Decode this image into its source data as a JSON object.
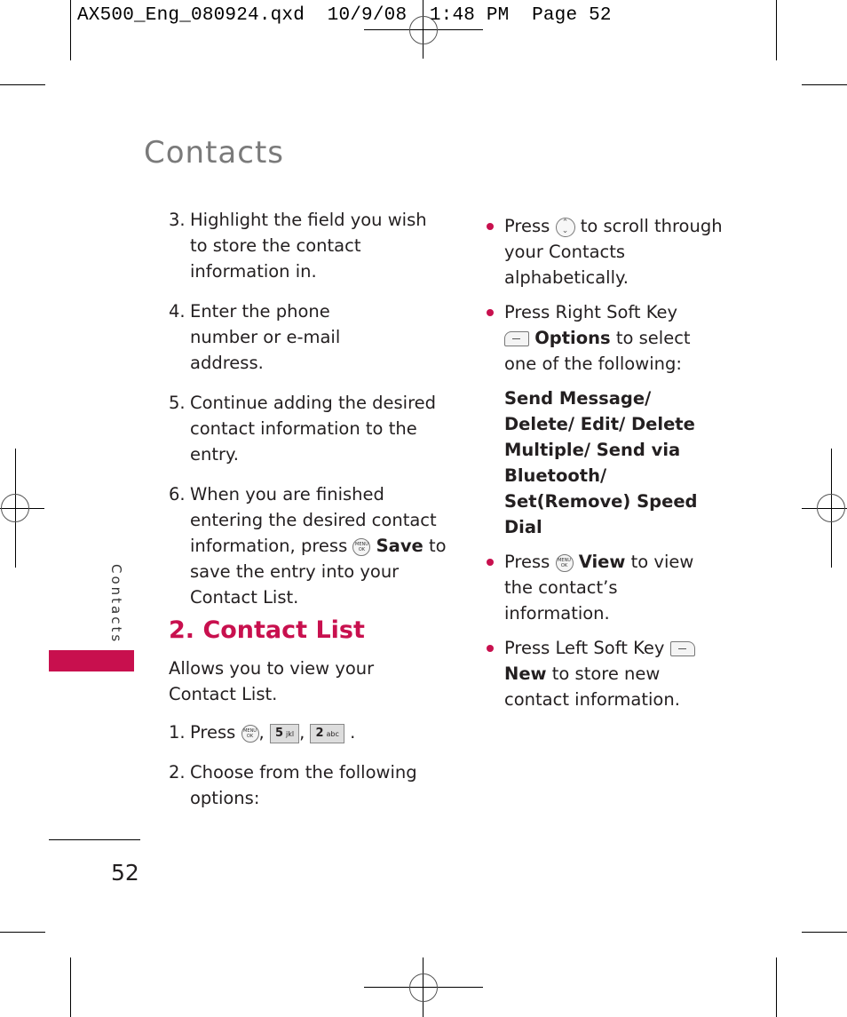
{
  "slug": "AX500_Eng_080924.qxd  10/9/08  1:48 PM  Page 52",
  "page": {
    "title": "Contacts",
    "side_tab": "Contacts",
    "page_number": "52",
    "accent_color": "#c8104e"
  },
  "left_column": {
    "steps_top": [
      {
        "num": "3.",
        "text": "Highlight the field you wish to store the contact information in."
      },
      {
        "num": "4.",
        "text": "Enter the phone number or e-mail address."
      },
      {
        "num": "5.",
        "text": "Continue adding the desired contact information to the entry."
      },
      {
        "num": "6.",
        "text_before": "When you are finished entering the desired contact information, press",
        "icon": "menu-ok-key",
        "bold": "Save",
        "text_after": "to save the entry into your Contact List."
      }
    ],
    "section_heading": "2. Contact List",
    "section_intro": "Allows you to view your Contact List.",
    "steps_bottom": [
      {
        "num": "1.",
        "text": "Press",
        "keys": [
          "MENU OK",
          "5 jkl",
          "2 abc"
        ]
      },
      {
        "num": "2.",
        "text": "Choose from the following options:"
      }
    ]
  },
  "right_column": {
    "bullets": [
      {
        "text_before": "Press",
        "icon": "navigation-key",
        "text_after": "to scroll through your Contacts alphabetically."
      },
      {
        "text_before": "Press Right Soft Key",
        "icon": "right-soft-key",
        "bold": "Options",
        "text_after": "to select one of the following:"
      },
      {
        "text_before": "Press",
        "icon": "menu-ok-key",
        "bold": "View",
        "text_after": "to view the contact’s information."
      },
      {
        "text_before": "Press Left Soft Key",
        "icon": "left-soft-key",
        "bold": "New",
        "text_after": "to store new contact information."
      }
    ],
    "options_list": "Send Message/ Delete/ Edit/ Delete Multiple/ Send via Bluetooth/ Set(Remove) Speed Dial"
  },
  "keys": {
    "menu_top": "MENU",
    "menu_bottom": "OK",
    "key5_num": "5",
    "key5_letters": "jkl",
    "key2_num": "2",
    "key2_letters": "abc",
    "nav_up": "⌃",
    "nav_down": "⌄"
  }
}
